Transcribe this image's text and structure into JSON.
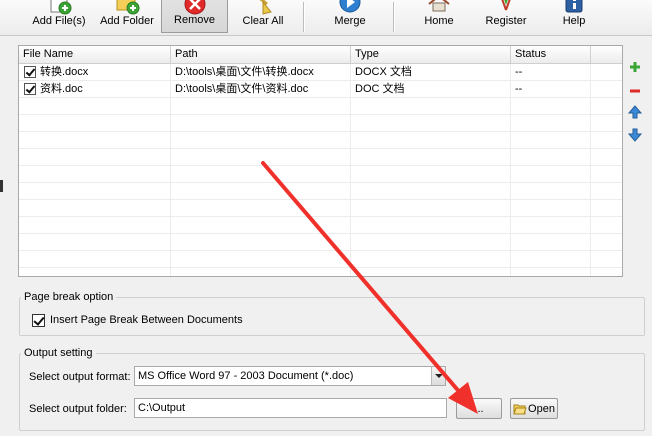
{
  "toolbar": {
    "add_files": "Add File(s)",
    "add_folder": "Add Folder",
    "remove": "Remove",
    "clear_all": "Clear All",
    "merge": "Merge",
    "home": "Home",
    "register": "Register",
    "help": "Help"
  },
  "grid": {
    "columns": [
      "File Name",
      "Path",
      "Type",
      "Status"
    ],
    "rows": [
      {
        "checked": true,
        "name": "转换.docx",
        "path": "D:\\tools\\桌面\\文件\\转换.docx",
        "type": "DOCX 文档",
        "status": "--"
      },
      {
        "checked": true,
        "name": "资料.doc",
        "path": "D:\\tools\\桌面\\文件\\资料.doc",
        "type": "DOC 文档",
        "status": "--"
      }
    ]
  },
  "page_break": {
    "group_title": "Page break option",
    "checkbox_label": "Insert Page Break Between Documents",
    "checked": true
  },
  "output": {
    "group_title": "Output setting",
    "format_label": "Select output format:",
    "format_value": "MS Office Word 97 - 2003 Document (*.doc)",
    "folder_label": "Select output folder:",
    "folder_value": "C:\\Output",
    "browse_label": "...",
    "open_label": "Open"
  },
  "colors": {
    "annotation_arrow": "#f0302a",
    "add_green": "#3aa535",
    "remove_red": "#e02a2a",
    "move_blue": "#3b8ad8"
  },
  "icons": [
    "add-file-icon",
    "add-folder-icon",
    "remove-icon",
    "broom-icon",
    "merge-icon",
    "home-icon",
    "register-icon",
    "help-icon",
    "plus-icon",
    "minus-icon",
    "arrow-up-icon",
    "arrow-down-icon",
    "folder-open-icon"
  ]
}
